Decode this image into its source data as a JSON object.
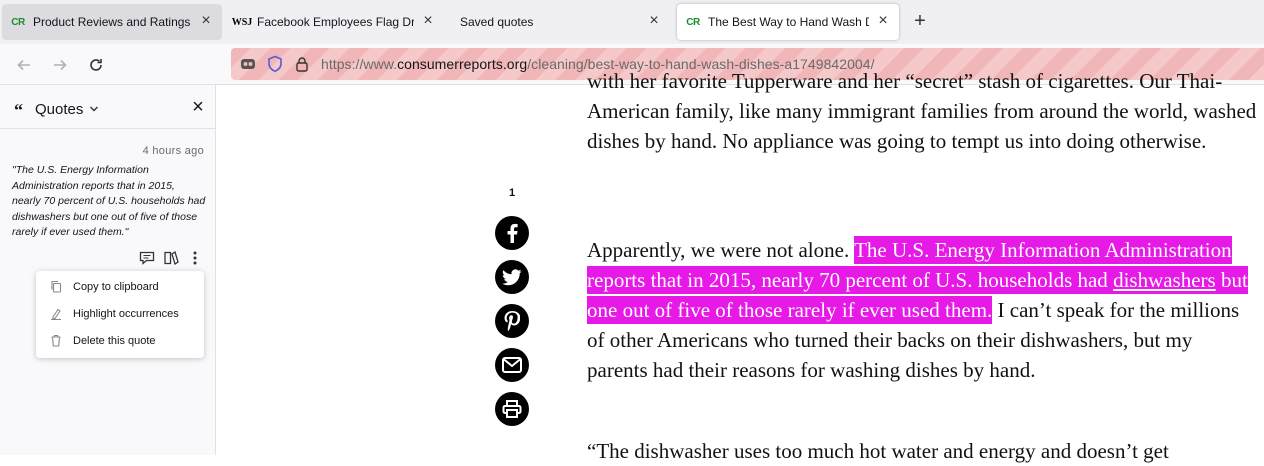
{
  "tabs": [
    {
      "title": "Product Reviews and Ratings - ",
      "favicon": "CR",
      "close": "×"
    },
    {
      "title": "Facebook Employees Flag Drug",
      "favicon": "WSJ",
      "close": "×"
    },
    {
      "title": "Saved quotes",
      "favicon": "",
      "close": "×"
    },
    {
      "title": "The Best Way to Hand Wash Dis",
      "favicon": "CR",
      "close": "×"
    }
  ],
  "new_tab_label": "+",
  "url": {
    "prefix": "https://www.",
    "domain": "consumerreports.org",
    "path": "/cleaning/best-way-to-hand-wash-dishes-a1749842004/"
  },
  "sidebar": {
    "title": "Quotes",
    "close": "×",
    "quote": {
      "time": "4 hours ago",
      "text": "\"The U.S. Energy Information Administration reports that in 2015, nearly 70 percent of U.S. households had dishwashers but one out of five of those rarely if ever used them.\""
    },
    "menu": [
      {
        "label": "Copy to clipboard",
        "icon": "copy-icon"
      },
      {
        "label": "Highlight occurrences",
        "icon": "highlight-icon"
      },
      {
        "label": "Delete this quote",
        "icon": "trash-icon"
      }
    ]
  },
  "share": {
    "count": "1",
    "buttons": [
      "facebook-icon",
      "twitter-icon",
      "pinterest-icon",
      "email-icon",
      "print-icon"
    ]
  },
  "article": {
    "para1": "with her favorite Tupperware and her “secret” stash of cigarettes. Our Thai-American family, like many immigrant families from around the world, washed dishes by hand. No appliance was going to tempt us into doing otherwise.",
    "para2_before": "Apparently, we were not alone. ",
    "para2_highlight_a": "The U.S. Energy Information Administration reports that in 2015, nearly 70 percent of U.S. households had ",
    "para2_highlight_link": "dishwashers",
    "para2_highlight_b": " but one out of five of those rarely if ever used them.",
    "para2_after": " I can’t speak for the millions of other Americans who turned their backs on their dishwashers, but my parents had their reasons for washing dishes by hand.",
    "para3": "“The dishwasher uses too much hot water and energy and doesn’t get"
  },
  "colors": {
    "highlight": "#e619e6",
    "cr_green": "#1b8c2e",
    "private_stripe": "#f0b6b8"
  }
}
